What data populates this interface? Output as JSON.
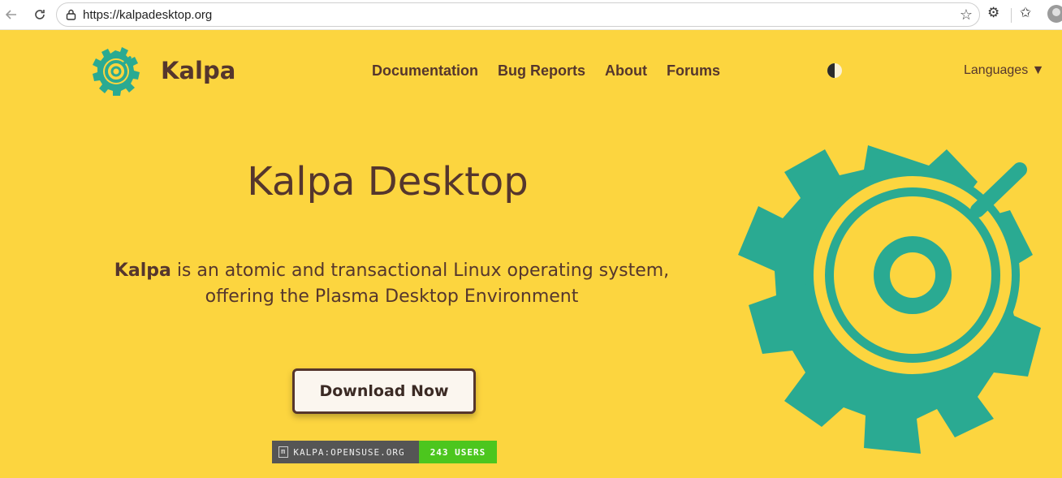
{
  "browser": {
    "url": "https://kalpadesktop.org",
    "icons": [
      "back-arrow-icon",
      "reload-icon",
      "lock-icon",
      "star-icon",
      "extensions-icon",
      "favorites-icon",
      "profile-icon"
    ]
  },
  "header": {
    "brand": "Kalpa",
    "nav": [
      "Documentation",
      "Bug Reports",
      "About",
      "Forums"
    ],
    "languages": "Languages ▼"
  },
  "hero": {
    "title": "Kalpa Desktop",
    "desc_bold": "Kalpa",
    "desc_rest_line1": " is an atomic and transactional Linux operating system,",
    "desc_line2": "offering the Plasma Desktop Environment",
    "download_label": "Download Now"
  },
  "badge": {
    "left": "KALPA:OPENSUSE.ORG",
    "right": "243 USERS",
    "glyph": "m"
  },
  "colors": {
    "background": "#fcd53f",
    "text_brown": "#55362d",
    "gear_teal": "#2aaa92",
    "badge_green": "#4cc61e",
    "badge_grey": "#555555"
  }
}
